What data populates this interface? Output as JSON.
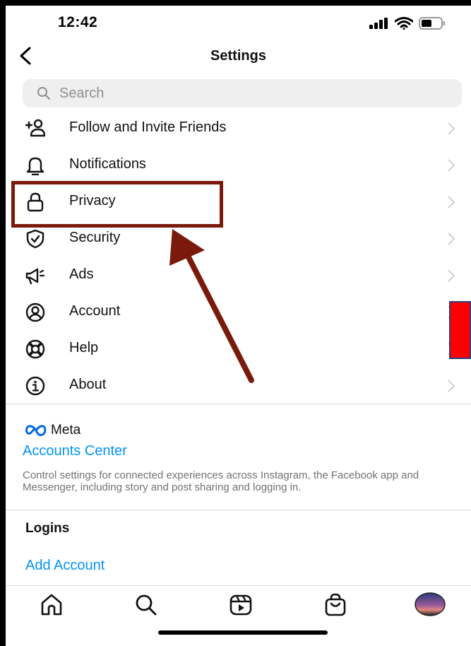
{
  "status_bar": {
    "time": "12:42",
    "icons": [
      "signal-icon",
      "wifi-icon",
      "battery-icon"
    ]
  },
  "header": {
    "title": "Settings",
    "back_icon": "chevron-left-icon"
  },
  "search": {
    "placeholder": "Search",
    "value": ""
  },
  "settings": {
    "items": [
      {
        "label": "Follow and Invite Friends",
        "icon": "add-person-icon"
      },
      {
        "label": "Notifications",
        "icon": "bell-icon"
      },
      {
        "label": "Privacy",
        "icon": "lock-icon"
      },
      {
        "label": "Security",
        "icon": "shield-check-icon"
      },
      {
        "label": "Ads",
        "icon": "megaphone-icon"
      },
      {
        "label": "Account",
        "icon": "account-circle-icon"
      },
      {
        "label": "Help",
        "icon": "lifebuoy-icon"
      },
      {
        "label": "About",
        "icon": "info-icon"
      }
    ]
  },
  "meta": {
    "brand": "Meta",
    "accounts_center": "Accounts Center",
    "description": "Control settings for connected experiences across Instagram, the Facebook app and Messenger, including story and post sharing and logging in."
  },
  "logins": {
    "title": "Logins",
    "add_account": "Add Account"
  },
  "tab_bar": {
    "tabs": [
      "home-icon",
      "search-icon",
      "reels-icon",
      "shop-icon",
      "profile-avatar"
    ]
  },
  "colors": {
    "link_blue": "#0095f6",
    "annotation_box": "#7a1a0c",
    "annotation_arrow": "#7a1a0c",
    "red_marker": "#ff0000"
  }
}
